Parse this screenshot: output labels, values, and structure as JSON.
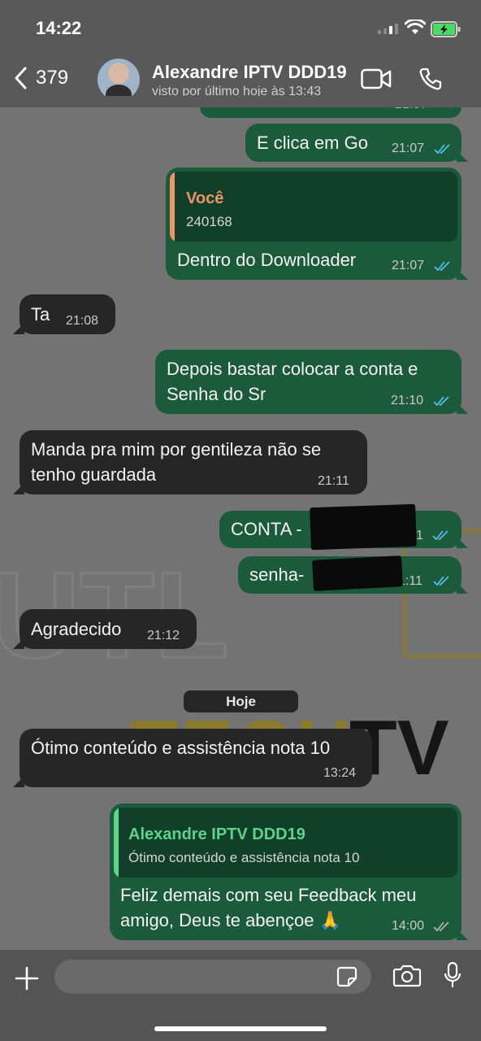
{
  "status_bar": {
    "time": "14:22"
  },
  "header": {
    "back_count": "379",
    "contact_name": "Alexandre IPTV DDD19",
    "contact_status": "visto por último hoje às 13:43"
  },
  "messages": [
    {
      "dir": "out",
      "text": "E clica em Go",
      "time": "21:07"
    },
    {
      "dir": "out",
      "quote_author": "Você",
      "quote_text": "240168",
      "text": "Dentro do Downloader",
      "time": "21:07"
    },
    {
      "dir": "in",
      "text": "Ta",
      "time": "21:08"
    },
    {
      "dir": "out",
      "text": "Depois bastar colocar a conta e\nSenha do Sr",
      "time": "21:10"
    },
    {
      "dir": "in",
      "text": "Manda pra mim por gentileza não se\ntenho guardada",
      "time": "21:11"
    },
    {
      "dir": "out",
      "text": "CONTA -",
      "time": "21:11"
    },
    {
      "dir": "out",
      "text": "senha-",
      "time": "21:11"
    },
    {
      "dir": "in",
      "text": "Agradecido",
      "time": "21:12"
    },
    {
      "dir": "in",
      "text": "Ótimo conteúdo e assistência nota 10",
      "time": "13:24"
    },
    {
      "dir": "out",
      "quote_author": "Alexandre IPTV DDD19",
      "quote_text": "Ótimo conteúdo e assistência nota 10",
      "text": "Feliz demais com seu Feedback meu\namigo, Deus te abençoe 🙏",
      "time": "14:00"
    }
  ],
  "date_divider": "Hoje",
  "colors": {
    "outgoing_bubble": "#1c5a3c",
    "incoming_bubble": "#262626",
    "quote_you": "#f0926a",
    "quote_contact": "#5fd38a",
    "read_ticks": "#53bdeb",
    "delivered_ticks": "#b0b0b0"
  },
  "icons": [
    "back-chevron-icon",
    "video-call-icon",
    "phone-icon",
    "plus-icon",
    "sticker-icon",
    "camera-icon",
    "microphone-icon"
  ]
}
